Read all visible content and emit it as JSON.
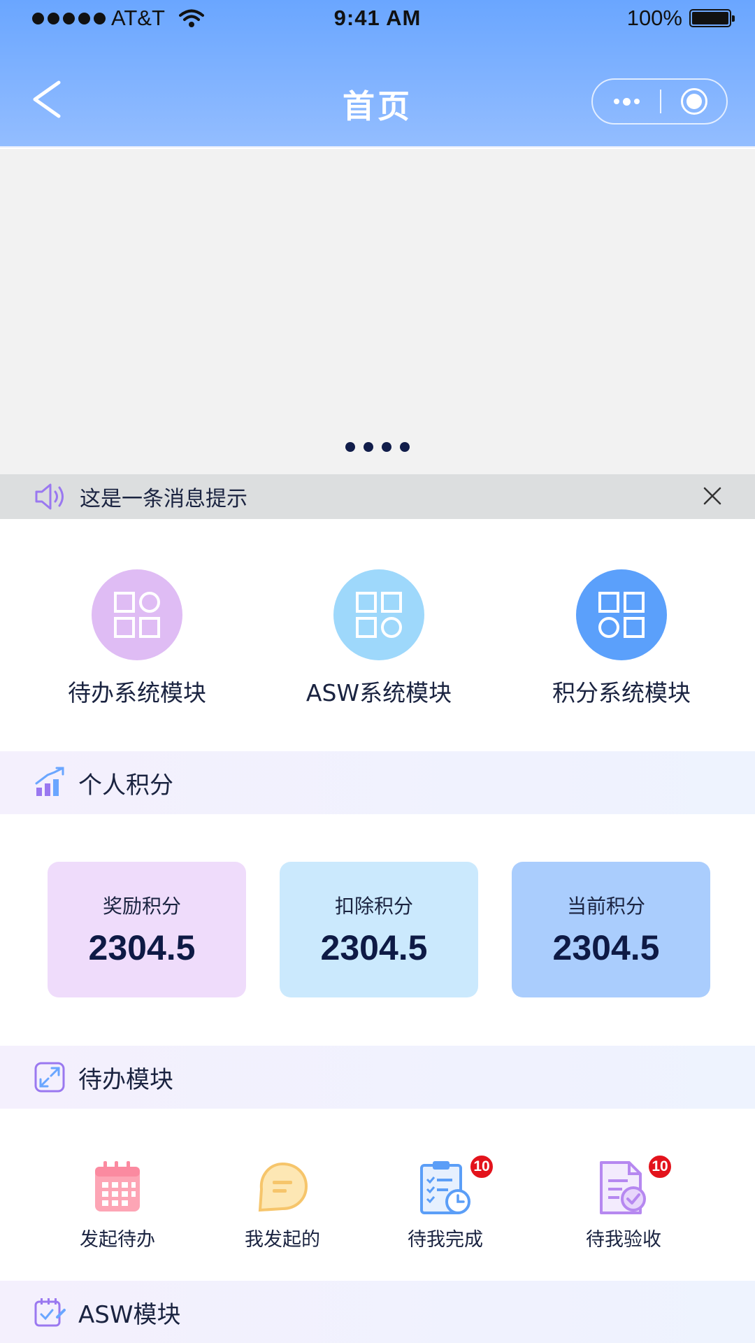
{
  "status_bar": {
    "carrier": "AT&T",
    "time": "9:41 AM",
    "battery": "100%"
  },
  "nav": {
    "title": "首页"
  },
  "banner": {
    "page_count": 4
  },
  "notice": {
    "text": "这是一条消息提示"
  },
  "modules": [
    {
      "label": "待办系统模块",
      "color": "#dfbcf4",
      "icon": "grid-icon"
    },
    {
      "label": "ASW系统模块",
      "color": "#9ed8fb",
      "icon": "grid-icon"
    },
    {
      "label": "积分系统模块",
      "color": "#5ba0fb",
      "icon": "grid-icon"
    }
  ],
  "personal_points": {
    "title": "个人积分",
    "cards": [
      {
        "label": "奖励积分",
        "value": "2304.5",
        "color": "#efdcfb"
      },
      {
        "label": "扣除积分",
        "value": "2304.5",
        "color": "#cbe9fd"
      },
      {
        "label": "当前积分",
        "value": "2304.5",
        "color": "#aacdfd"
      }
    ]
  },
  "todo_module": {
    "title": "待办模块",
    "items": [
      {
        "label": "发起待办",
        "icon": "calendar-icon",
        "badge": ""
      },
      {
        "label": "我发起的",
        "icon": "chat-icon",
        "badge": ""
      },
      {
        "label": "待我完成",
        "icon": "clipboard-clock-icon",
        "badge": "10"
      },
      {
        "label": "待我验收",
        "icon": "document-check-icon",
        "badge": "10"
      }
    ]
  },
  "asw_module": {
    "title": "ASW模块"
  }
}
